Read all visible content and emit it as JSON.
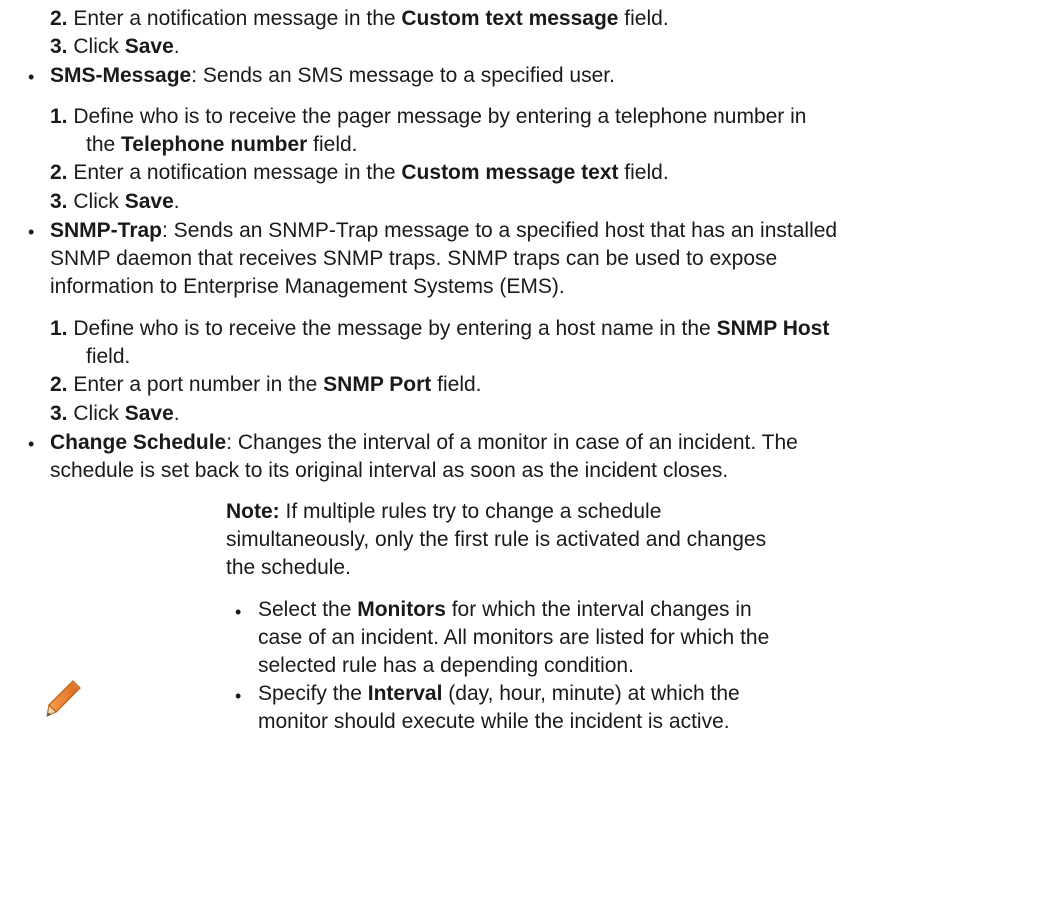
{
  "doc": {
    "top": {
      "s2": {
        "num": "2.",
        "pre": "Enter a notification message in the ",
        "b": "Custom text message",
        "post": " field."
      },
      "s3": {
        "num": "3.",
        "pre": "Click ",
        "b": "Save",
        "post": "."
      }
    },
    "sms": {
      "title": "SMS-Message",
      "desc": ": Sends an SMS message to a specified user.",
      "s1": {
        "num": "1.",
        "line1": "Define who is to receive the pager message by entering a telephone number in",
        "pre2": "the ",
        "b": "Telephone number",
        "post2": " field."
      },
      "s2": {
        "num": "2.",
        "pre": "Enter a notification message in the ",
        "b": "Custom message text",
        "post": " field."
      },
      "s3": {
        "num": "3.",
        "pre": "Click ",
        "b": "Save",
        "post": "."
      }
    },
    "snmp": {
      "title": "SNMP-Trap",
      "desc_l1": ": Sends an SNMP-Trap message to a specified host that has an installed",
      "desc_l2": "SNMP daemon that receives SNMP traps. SNMP traps can be used to expose",
      "desc_l3": "information to Enterprise Management Systems (EMS).",
      "s1": {
        "num": "1.",
        "pre": "Define who is to receive the message by entering a host name in the ",
        "b": "SNMP Host",
        "line2": "field."
      },
      "s2": {
        "num": "2.",
        "pre": "Enter a port number in the ",
        "b": "SNMP Port",
        "post": " field."
      },
      "s3": {
        "num": "3.",
        "pre": "Click ",
        "b": "Save",
        "post": "."
      }
    },
    "change": {
      "title": "Change Schedule",
      "desc_l1": ": Changes the interval of a monitor in case of an incident. The",
      "desc_l2": "schedule is set back to its original interval as soon as the incident closes.",
      "note": {
        "label": "Note:",
        "l1": " If multiple rules try to change a schedule",
        "l2": "simultaneously, only the first rule is activated and changes",
        "l3": "the schedule."
      },
      "b1": {
        "pre": "Select the ",
        "b": "Monitors",
        "post": " for which the interval changes in",
        "l2": "case of an incident. All monitors are listed for which the",
        "l3": "selected rule has a depending condition."
      },
      "b2": {
        "pre": "Specify the ",
        "b": "Interval",
        "post": " (day, hour, minute) at which the",
        "l2": "monitor should execute while the incident is active."
      }
    },
    "bullet_glyph": "•",
    "icons": {
      "note": "pencil-icon"
    }
  }
}
